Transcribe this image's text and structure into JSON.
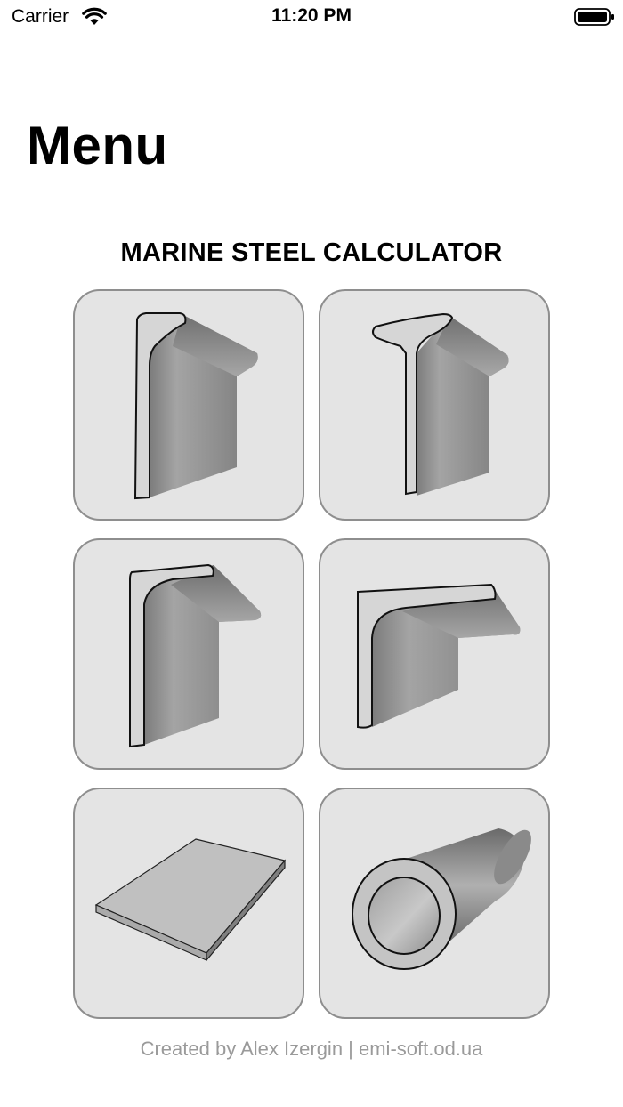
{
  "status_bar": {
    "carrier": "Carrier",
    "time": "11:20 PM",
    "icons": [
      "wifi-icon",
      "battery-icon"
    ]
  },
  "title": "Menu",
  "heading": "MARINE STEEL CALCULATOR",
  "tiles": [
    {
      "icon": "bulb-flat-profile-icon"
    },
    {
      "icon": "tee-bulb-profile-icon"
    },
    {
      "icon": "unequal-angle-profile-icon"
    },
    {
      "icon": "equal-angle-profile-icon"
    },
    {
      "icon": "steel-plate-icon"
    },
    {
      "icon": "steel-pipe-icon"
    }
  ],
  "footer": "Created by Alex Izergin | emi-soft.od.ua"
}
